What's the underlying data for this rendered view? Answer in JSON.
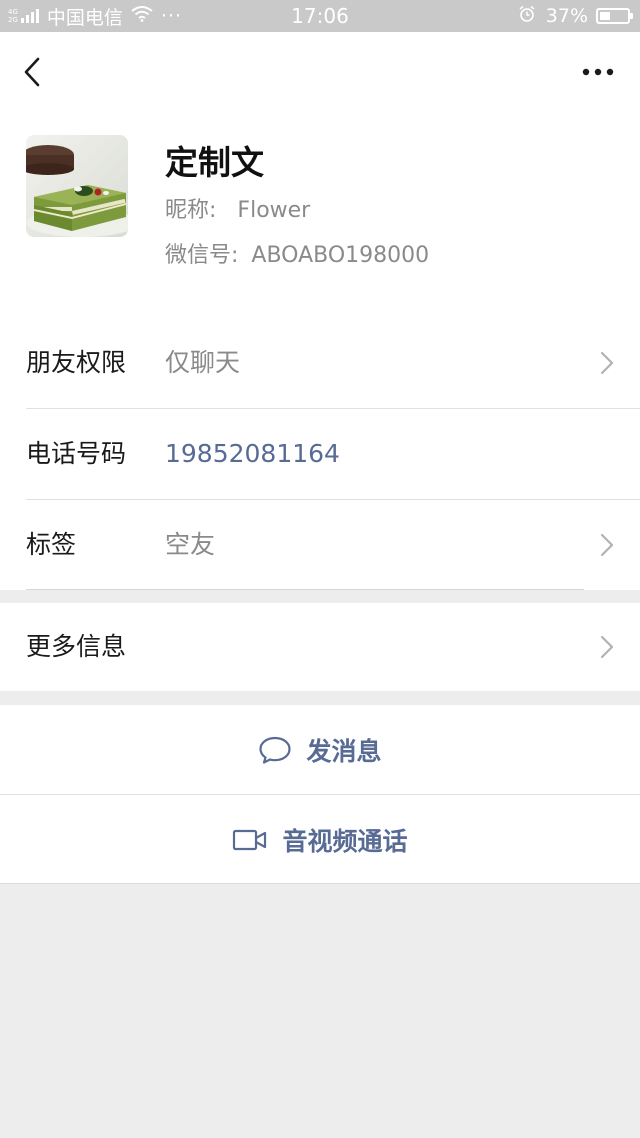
{
  "status_bar": {
    "network_gen_top": "4G",
    "network_gen_bottom": "2G",
    "carrier": "中国电信",
    "extra_dots": "···",
    "time": "17:06",
    "battery_percent": "37%",
    "battery_level": 0.37,
    "icons": [
      "signal-icon",
      "wifi-icon",
      "alarm-icon",
      "battery-icon"
    ]
  },
  "nav": {
    "back_icon": "chevron-left-icon",
    "more_icon": "more-dots-icon"
  },
  "profile": {
    "name": "定制文",
    "nickname_label": "昵称:",
    "nickname": "Flower",
    "wechat_id_label": "微信号:",
    "wechat_id": "ABOABO198000"
  },
  "info": {
    "permissions": {
      "label": "朋友权限",
      "value": "仅聊天"
    },
    "phone": {
      "label": "电话号码",
      "value": "19852081164"
    },
    "tags": {
      "label": "标签",
      "value": "空友"
    },
    "more_info": {
      "label": "更多信息"
    }
  },
  "actions": {
    "message": {
      "label": "发消息",
      "icon": "chat-bubble-icon"
    },
    "call": {
      "label": "音视频通话",
      "icon": "video-camera-icon"
    }
  },
  "colors": {
    "link": "#576b95",
    "background": "#ededed",
    "status_bar": "#c9c9c9",
    "secondary_text": "#8a8a8a"
  }
}
